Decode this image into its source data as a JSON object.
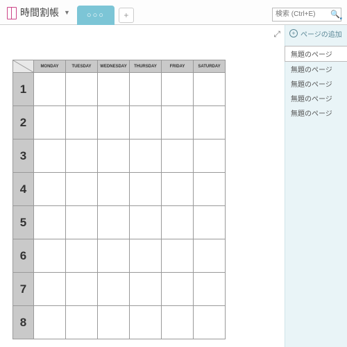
{
  "header": {
    "notebook_label": "時間割帳",
    "section_tab_label": "○○○",
    "add_tab_label": "+",
    "search_placeholder": "検索 (Ctrl+E)"
  },
  "canvas": {
    "table": {
      "columns": [
        "MONDAY",
        "TUESDAY",
        "WEDNESDAY",
        "THURSDAY",
        "FRIDAY",
        "SATURDAY"
      ],
      "rows": [
        "1",
        "2",
        "3",
        "4",
        "5",
        "6",
        "7",
        "8"
      ]
    }
  },
  "sidepanel": {
    "add_page_label": "ページの追加",
    "pages": [
      "無題のページ",
      "無題のページ",
      "無題のページ",
      "無題のページ",
      "無題のページ"
    ],
    "active_index": 0
  }
}
